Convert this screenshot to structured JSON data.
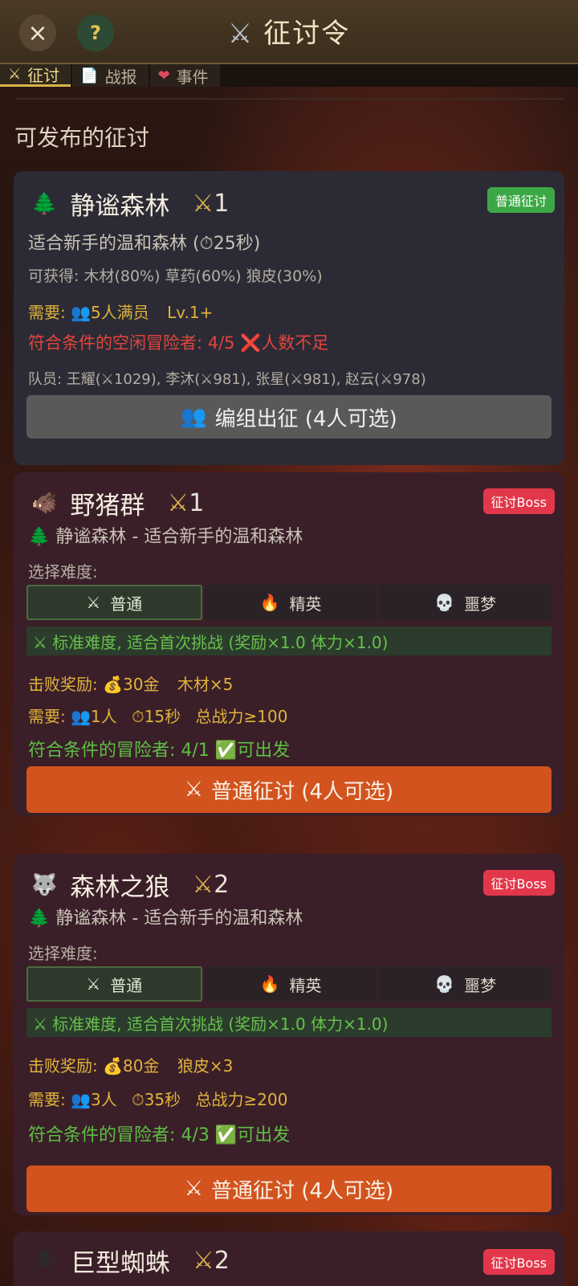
{
  "header": {
    "close_icon": "×",
    "help_icon": "?",
    "title_icon": "⚔",
    "title": "征讨令"
  },
  "tabs": [
    {
      "icon": "⚔",
      "label": "征讨",
      "active": true
    },
    {
      "icon": "📄",
      "label": "战报",
      "active": false
    },
    {
      "icon": "❤",
      "label": "事件",
      "active": false
    }
  ],
  "section_title": "可发布的征讨",
  "zone_card": {
    "icon": "🌲",
    "name": "静谧森林",
    "level_icon": "⚔",
    "level": "1",
    "badge": "普通征讨",
    "desc": "适合新手的温和森林 (⏱25秒)",
    "rewards": "可获得: 木材(80%) 草药(60%) 狼皮(30%)",
    "req_label": "需要:",
    "req_icon": "👥",
    "req_people": "5人满员",
    "req_level": "Lv.1+",
    "eligible": "符合条件的空闲冒险者: 4/5",
    "eligible_status": "❌人数不足",
    "members": "队员: 王耀(⚔1029), 李沐(⚔981), 张星(⚔981), 赵云(⚔978)",
    "button_icon": "👥",
    "button": "编组出征 (4人可选)"
  },
  "boss_cards": [
    {
      "icon": "🐗",
      "name": "野猪群",
      "level_icon": "⚔",
      "level": "1",
      "badge": "征讨Boss",
      "location_icon": "🌲",
      "location": "静谧森林 - 适合新手的温和森林",
      "select_label": "选择难度:",
      "difficulties": [
        {
          "icon": "⚔",
          "label": "普通",
          "selected": true
        },
        {
          "icon": "🔥",
          "label": "精英",
          "selected": false
        },
        {
          "icon": "💀",
          "label": "噩梦",
          "selected": false
        }
      ],
      "diff_desc": "⚔ 标准难度, 适合首次挑战 (奖励×1.0  体力×1.0)",
      "reward_label": "击败奖励:",
      "reward_gold": "💰30金",
      "reward_item": "木材×5",
      "req_label": "需要:",
      "req_people": "👥1人",
      "req_time": "⏱15秒",
      "req_power": "总战力≥100",
      "eligible": "符合条件的冒险者: 4/1",
      "eligible_status": "✅可出发",
      "button_icon": "⚔",
      "button": "普通征讨 (4人可选)"
    },
    {
      "icon": "🐺",
      "name": "森林之狼",
      "level_icon": "⚔",
      "level": "2",
      "badge": "征讨Boss",
      "location_icon": "🌲",
      "location": "静谧森林 - 适合新手的温和森林",
      "select_label": "选择难度:",
      "difficulties": [
        {
          "icon": "⚔",
          "label": "普通",
          "selected": true
        },
        {
          "icon": "🔥",
          "label": "精英",
          "selected": false
        },
        {
          "icon": "💀",
          "label": "噩梦",
          "selected": false
        }
      ],
      "diff_desc": "⚔ 标准难度, 适合首次挑战 (奖励×1.0  体力×1.0)",
      "reward_label": "击败奖励:",
      "reward_gold": "💰80金",
      "reward_item": "狼皮×3",
      "req_label": "需要:",
      "req_people": "👥3人",
      "req_time": "⏱35秒",
      "req_power": "总战力≥200",
      "eligible": "符合条件的冒险者: 4/3",
      "eligible_status": "✅可出发",
      "button_icon": "⚔",
      "button": "普通征讨 (4人可选)"
    },
    {
      "icon": "🕷",
      "name": "巨型蜘蛛",
      "level_icon": "⚔",
      "level": "2",
      "badge": "征讨Boss"
    }
  ]
}
